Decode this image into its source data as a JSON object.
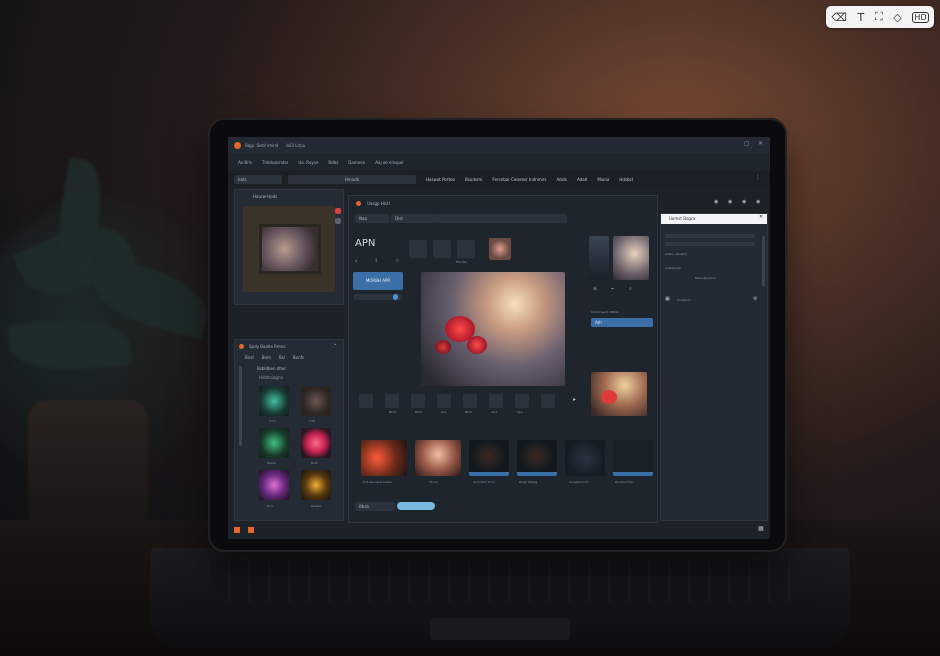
{
  "app": {
    "title": "Bqgi. Slsbl imind",
    "subtitle": "b03 Llrpu",
    "menu": [
      "Ao Brls",
      "Tmbluacndar",
      "Ua. Ruysn",
      "Bdbz",
      "Damnon",
      "Aaj eo einspor"
    ],
    "toolbar_select_1": "bats",
    "toolbar_select_2": "Hmadb",
    "toolbar_tabs": [
      "Haswot Porteo",
      "Bsudsrm",
      "Fersnbar Celeresr Indnmirs",
      "Adsls",
      "Adalt",
      "Miona",
      "Hdsbst"
    ]
  },
  "left_top_panel": {
    "title": "Haurw Hpds"
  },
  "left_bottom_panel": {
    "title": "Spdy Baahe Rmns",
    "tabs": [
      "Bnsf",
      "Bnm",
      "Bsl",
      "Bonfs"
    ],
    "group_title": "Bsbldben dhor",
    "group_sub": "Hdldtsiagna",
    "thumb_captions": [
      "Conc",
      "Ldfs",
      "Sbaho",
      "Brdn",
      "Dnu",
      "Sembo"
    ]
  },
  "editor": {
    "title": "Uasgp Hlstl",
    "select_a": "Naa",
    "select_b": "Dlst",
    "heading": "APN",
    "action_button": "MORBH APR",
    "mini_caption": "Ndndbj",
    "right_select_label": "Udobinsacb 38b0e",
    "right_select_value": "Arh",
    "bottom_captions": [
      "Bbrd",
      "Rtnd",
      "Aso",
      "Blnd",
      "Abd",
      "Spa"
    ],
    "strip_captions": [
      "Enbnsa eans bnsdu",
      "Ahma",
      "Anmdshn Enro",
      "Blagr 00deg",
      "Anegbncmnt",
      "Bnmsunrthn"
    ],
    "footer_select": "Bbsb"
  },
  "side_panel": {
    "title": "Uomst Bogra",
    "labels": [
      "Allsbs uanabm",
      "Uelbsxssdr",
      "Nabs Bpsbtlrs"
    ],
    "footer": "Scuebnlx"
  },
  "colors": {
    "accent": "#4a8fcf",
    "brand": "#e4672c",
    "screen_bg": "#1d2229"
  },
  "overlay_icons": [
    "eraser-icon",
    "text-icon",
    "crop-icon",
    "compare-icon",
    "hd-icon"
  ],
  "overlay_hd_label": "HD"
}
